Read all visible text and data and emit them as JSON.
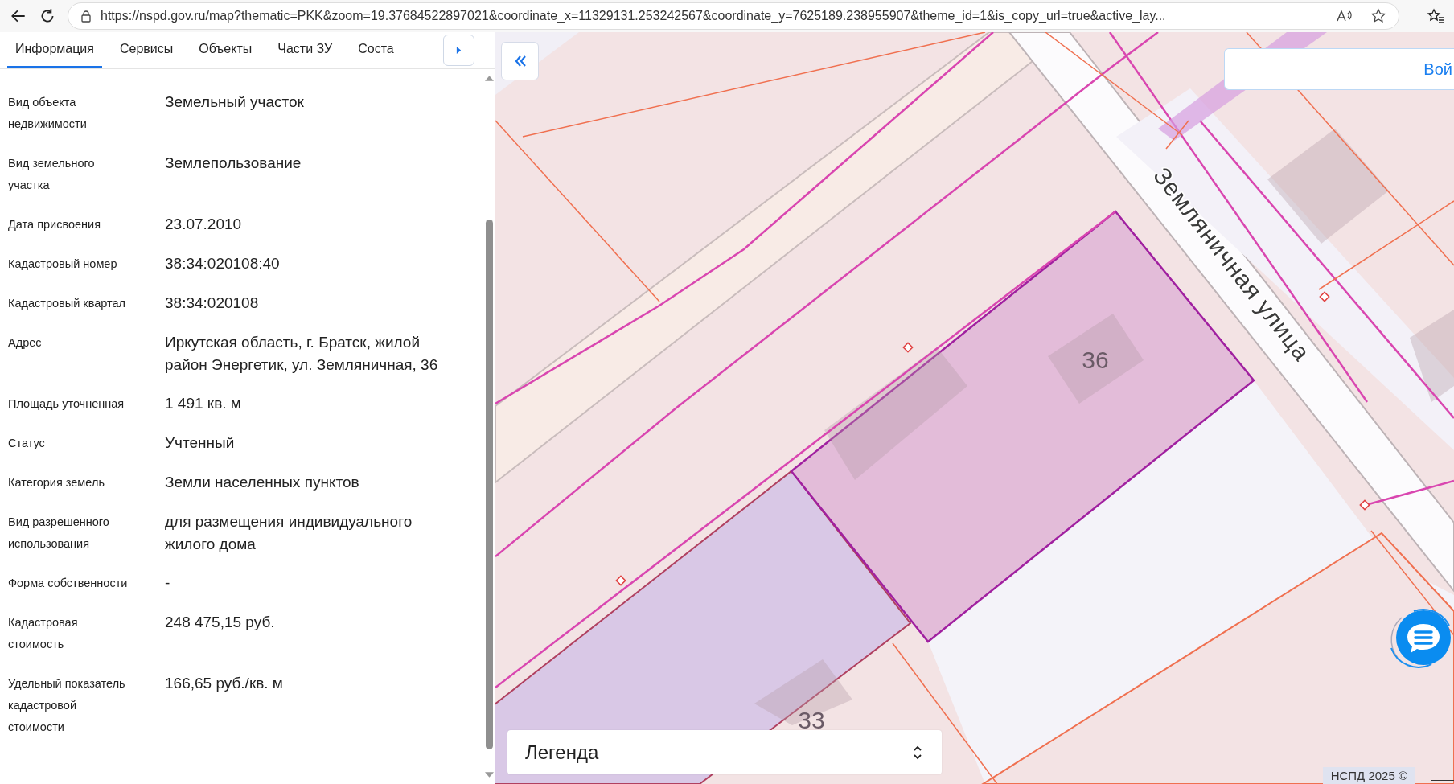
{
  "browser": {
    "url": "https://nspd.gov.ru/map?thematic=PKK&zoom=19.37684522897021&coordinate_x=11329131.253242567&coordinate_y=7625189.238955907&theme_id=1&is_copy_url=true&active_lay..."
  },
  "tabs": [
    {
      "label": "Информация",
      "selected": true
    },
    {
      "label": "Сервисы",
      "selected": false
    },
    {
      "label": "Объекты",
      "selected": false
    },
    {
      "label": "Части ЗУ",
      "selected": false
    },
    {
      "label": "Соста",
      "selected": false
    }
  ],
  "properties": [
    {
      "label": "Вид объекта недвижимости",
      "value": "Земельный участок"
    },
    {
      "label": "Вид земельного участка",
      "value": "Землепользование"
    },
    {
      "label": "Дата присвоения",
      "value": "23.07.2010"
    },
    {
      "label": "Кадастровый номер",
      "value": "38:34:020108:40"
    },
    {
      "label": "Кадастровый квартал",
      "value": "38:34:020108"
    },
    {
      "label": "Адрес",
      "value": "Иркутская область, г. Братск, жилой район Энергетик, ул. Земляничная, 36"
    },
    {
      "label": "Площадь уточненная",
      "value": "1 491 кв. м"
    },
    {
      "label": "Статус",
      "value": "Учтенный"
    },
    {
      "label": "Категория земель",
      "value": "Земли населенных пунктов"
    },
    {
      "label": "Вид разрешенного использования",
      "value": "для размещения индивидуального жилого дома"
    },
    {
      "label": "Форма собственности",
      "value": "-"
    },
    {
      "label": "Кадастровая стоимость",
      "value": "248 475,15 руб."
    },
    {
      "label": "Удельный показатель кадастровой стоимости",
      "value": "166,65 руб./кв. м"
    }
  ],
  "map": {
    "street_label": "Земляничная улица",
    "parcel_numbers": [
      "36",
      "33"
    ],
    "login_button": "Вой",
    "legend": {
      "title": "Легенда"
    },
    "footer": "НСПД 2025 ©"
  }
}
